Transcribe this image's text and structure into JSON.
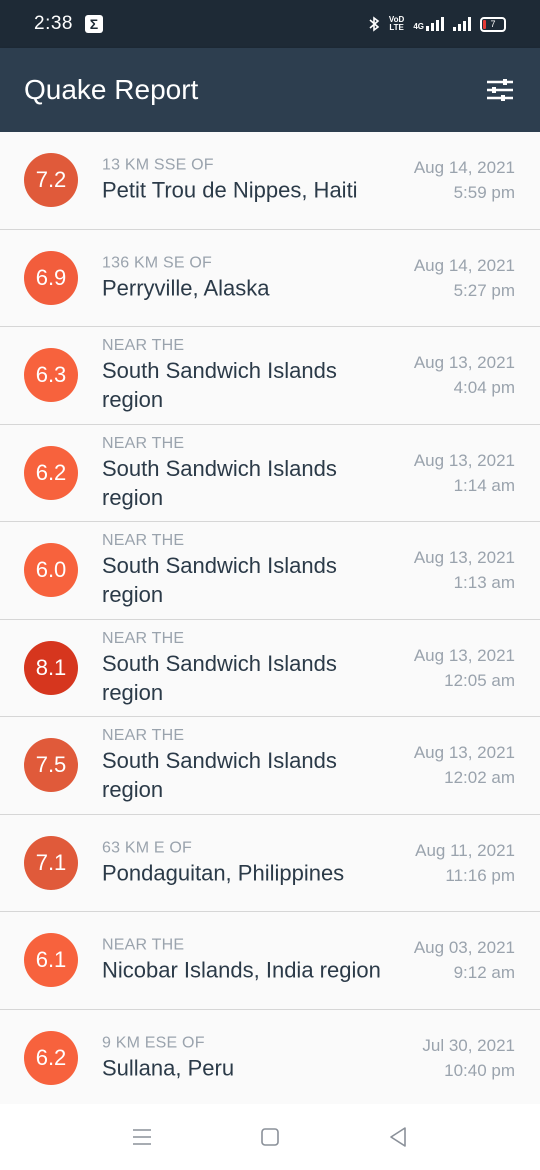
{
  "status": {
    "time": "2:38",
    "sigma": "Σ",
    "volte_top": "VoD",
    "volte_bottom": "LTE",
    "network": "4G",
    "battery": "7"
  },
  "app": {
    "title": "Quake Report"
  },
  "earthquakes": [
    {
      "mag": "7.2",
      "color": "#e05a3a",
      "offset": "13 KM SSE OF",
      "place": "Petit Trou de Nippes, Haiti",
      "date": "Aug 14, 2021",
      "time": "5:59 pm"
    },
    {
      "mag": "6.9",
      "color": "#f25d3c",
      "offset": "136 KM SE OF",
      "place": "Perryville, Alaska",
      "date": "Aug 14, 2021",
      "time": "5:27 pm"
    },
    {
      "mag": "6.3",
      "color": "#f7623d",
      "offset": "NEAR THE",
      "place": "South Sandwich Islands region",
      "date": "Aug 13, 2021",
      "time": "4:04 pm"
    },
    {
      "mag": "6.2",
      "color": "#f7623d",
      "offset": "NEAR THE",
      "place": "South Sandwich Islands region",
      "date": "Aug 13, 2021",
      "time": "1:14 am"
    },
    {
      "mag": "6.0",
      "color": "#f7623d",
      "offset": "NEAR THE",
      "place": "South Sandwich Islands region",
      "date": "Aug 13, 2021",
      "time": "1:13 am"
    },
    {
      "mag": "8.1",
      "color": "#d6361e",
      "offset": "NEAR THE",
      "place": "South Sandwich Islands region",
      "date": "Aug 13, 2021",
      "time": "12:05 am"
    },
    {
      "mag": "7.5",
      "color": "#e05a3a",
      "offset": "NEAR THE",
      "place": "South Sandwich Islands region",
      "date": "Aug 13, 2021",
      "time": "12:02 am"
    },
    {
      "mag": "7.1",
      "color": "#e05a3a",
      "offset": "63 KM E OF",
      "place": "Pondaguitan, Philippines",
      "date": "Aug 11, 2021",
      "time": "11:16 pm"
    },
    {
      "mag": "6.1",
      "color": "#f7623d",
      "offset": "NEAR THE",
      "place": "Nicobar Islands, India region",
      "date": "Aug 03, 2021",
      "time": "9:12 am"
    },
    {
      "mag": "6.2",
      "color": "#f7623d",
      "offset": "9 KM ESE OF",
      "place": "Sullana, Peru",
      "date": "Jul 30, 2021",
      "time": "10:40 pm"
    }
  ]
}
